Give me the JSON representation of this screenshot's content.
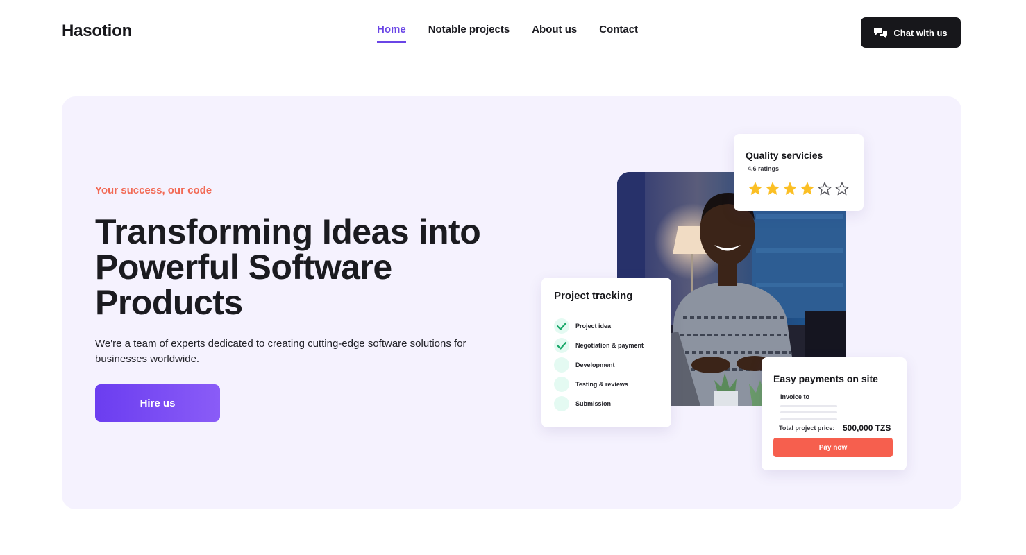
{
  "header": {
    "brand": "Hasotion",
    "nav": [
      {
        "label": "Home",
        "active": true
      },
      {
        "label": "Notable projects",
        "active": false
      },
      {
        "label": "About us",
        "active": false
      },
      {
        "label": "Contact",
        "active": false
      }
    ],
    "chat_button": {
      "label": "Chat with us",
      "icon": "chat-bubbles-icon"
    }
  },
  "hero": {
    "tagline": "Your success, our code",
    "headline": "Transforming Ideas into Powerful Software Products",
    "description": "We're a team of experts dedicated to creating cutting-edge software solutions for businesses worldwide.",
    "cta_label": "Hire us",
    "image": "smiling-developer-at-laptop-photo"
  },
  "quality_card": {
    "title": "Quality servicies",
    "rating_text": "4.6 ratings",
    "filled_stars": 4,
    "total_stars": 6
  },
  "tracking_card": {
    "title": "Project tracking",
    "steps": [
      {
        "label": "Project idea",
        "done": true
      },
      {
        "label": "Negotiation & payment",
        "done": true
      },
      {
        "label": "Development",
        "done": false
      },
      {
        "label": "Testing & reviews",
        "done": false
      },
      {
        "label": "Submission",
        "done": false
      }
    ]
  },
  "payment_card": {
    "title": "Easy payments on site",
    "invoice_label": "Invoice to",
    "total_label": "Total project price:",
    "total_value": "500,000 TZS",
    "pay_label": "Pay now"
  },
  "colors": {
    "accent": "#6a45e6",
    "hero_bg": "#f5f2fe",
    "tagline": "#f26a55",
    "pay_button": "#f65f4e",
    "star": "#fbbf24",
    "check": "#1aa86a"
  }
}
